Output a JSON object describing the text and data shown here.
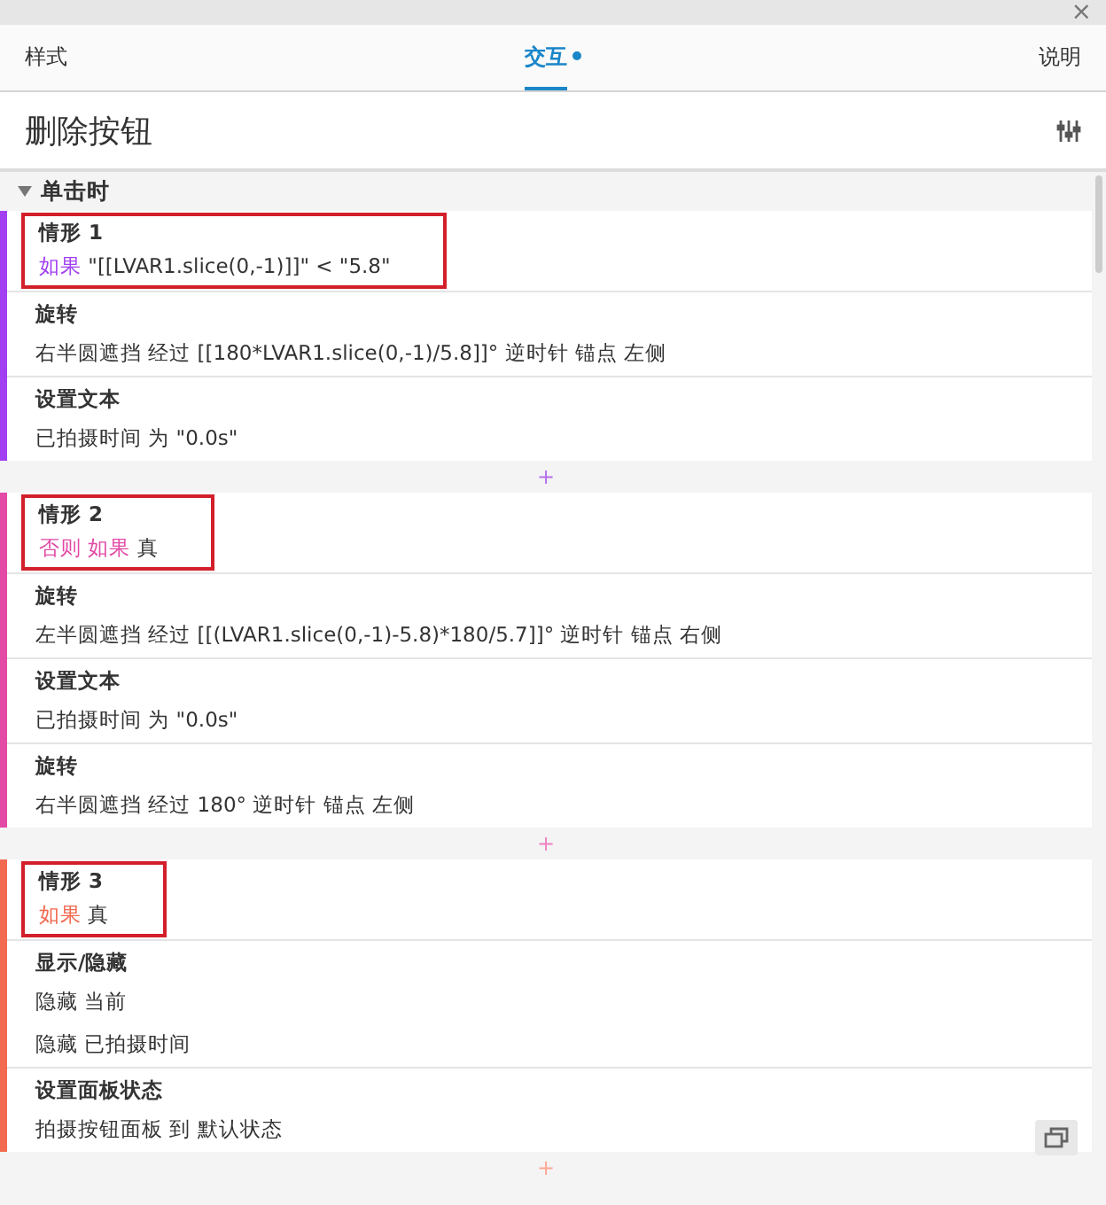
{
  "window": {
    "close": "×"
  },
  "tabs": [
    {
      "label": "样式",
      "selected": false,
      "dot": false
    },
    {
      "label": "交互",
      "selected": true,
      "dot": true
    },
    {
      "label": "说明",
      "selected": false,
      "dot": false
    }
  ],
  "widget_name": "删除按钮",
  "event": {
    "label": "单击时",
    "expanded": true
  },
  "cases": [
    {
      "title": "情形 1",
      "keyword": "如果",
      "condition": "\"[[LVAR1.slice(0,-1)]]\" < \"5.8\"",
      "color": "#a23ff0",
      "highlighted": true,
      "add": "+",
      "actions": [
        {
          "title": "旋转",
          "lines": [
            "右半圆遮挡 经过 [[180*LVAR1.slice(0,-1)/5.8]]° 逆时针  锚点 左侧"
          ]
        },
        {
          "title": "设置文本",
          "lines": [
            "已拍摄时间 为 \"0.0s\""
          ]
        }
      ]
    },
    {
      "title": "情形 2",
      "keyword": "否则 如果",
      "condition": "真",
      "color": "#e24aa6",
      "highlighted": true,
      "add": "+",
      "actions": [
        {
          "title": "旋转",
          "lines": [
            "左半圆遮挡 经过 [[(LVAR1.slice(0,-1)-5.8)*180/5.7]]° 逆时针  锚点 右侧"
          ]
        },
        {
          "title": "设置文本",
          "lines": [
            "已拍摄时间 为 \"0.0s\""
          ]
        },
        {
          "title": "旋转",
          "lines": [
            "右半圆遮挡 经过 180° 逆时针  锚点 左侧"
          ]
        }
      ]
    },
    {
      "title": "情形 3",
      "keyword": "如果",
      "condition": "真",
      "color": "#f26a50",
      "highlighted": true,
      "add": "+",
      "actions": [
        {
          "title": "显示/隐藏",
          "lines": [
            "隐藏 当前",
            "隐藏 已拍摄时间"
          ]
        },
        {
          "title": "设置面板状态",
          "lines": [
            "拍摄按钮面板 到 默认状态"
          ]
        }
      ]
    }
  ]
}
